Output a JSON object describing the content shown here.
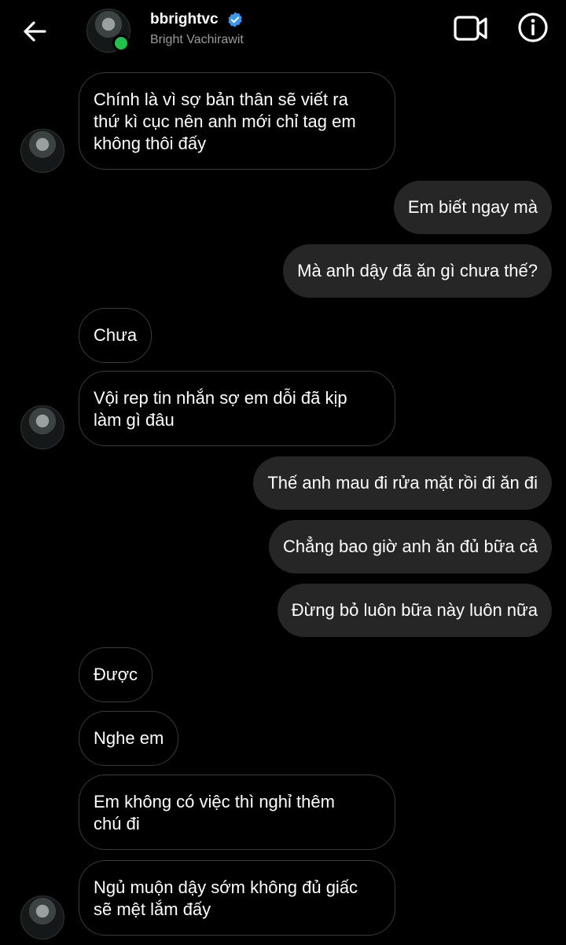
{
  "header": {
    "username": "bbrightvc",
    "full_name": "Bright Vachirawit",
    "verified_icon": "verified-badge-icon",
    "back_icon": "arrow-left-icon",
    "video_icon": "video-camera-icon",
    "info_icon": "info-icon",
    "online_color": "#1fc24a",
    "verified_color": "#3897f0"
  },
  "messages": [
    {
      "side": "in",
      "text": "Chính là vì sợ bản thân sẽ viết ra\nthứ kì cục nên anh mới chỉ tag em\nkhông thôi đấy"
    },
    {
      "side": "out",
      "text": "Em biết ngay mà"
    },
    {
      "side": "out",
      "text": "Mà anh dậy đã ăn gì chưa thế?"
    },
    {
      "side": "in",
      "text": "Chưa"
    },
    {
      "side": "in",
      "text": "Vội rep tin nhắn sợ em dỗi đã kịp\nlàm gì đâu"
    },
    {
      "side": "out",
      "text": "Thế anh mau đi rửa mặt rồi đi ăn đi"
    },
    {
      "side": "out",
      "text": "Chẳng bao giờ anh ăn đủ bữa cả"
    },
    {
      "side": "out",
      "text": "Đừng bỏ luôn bữa này luôn nữa"
    },
    {
      "side": "in",
      "text": "Được"
    },
    {
      "side": "in",
      "text": "Nghe em"
    },
    {
      "side": "in",
      "text": "Em không có việc thì nghỉ thêm\nchú đi"
    },
    {
      "side": "in",
      "text": "Ngủ muộn dậy sớm không đủ giấc\nsẽ mệt lắm đấy"
    }
  ]
}
